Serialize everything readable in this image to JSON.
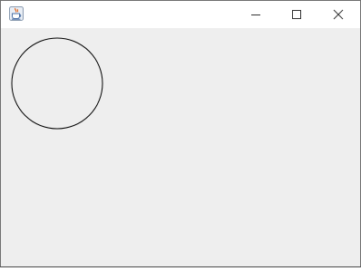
{
  "window": {
    "icon": "java-cup-icon",
    "controls": [
      "minimize-icon",
      "maximize-icon",
      "close-icon"
    ]
  },
  "canvas": {
    "shape": "circle",
    "stroke_color": "#000000",
    "background_color": "#eeeeee"
  }
}
